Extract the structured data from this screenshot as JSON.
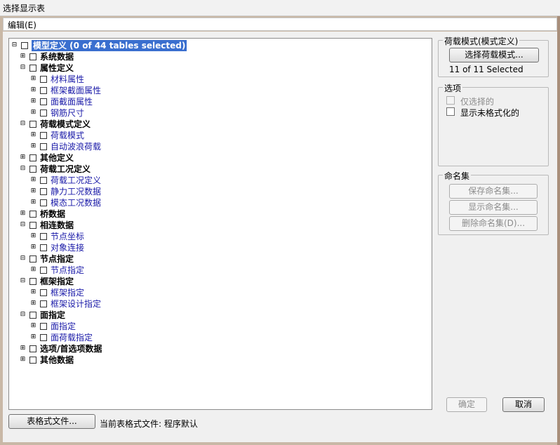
{
  "window": {
    "title": "选择显示表"
  },
  "menu": {
    "edit_label": "编辑(E)"
  },
  "tree": {
    "root_label": "模型定义  (0 of 44 tables selected)",
    "nodes": [
      {
        "label": "系统数据",
        "level": 1,
        "bold": true
      },
      {
        "label": "属性定义",
        "level": 1,
        "bold": true,
        "expanded": true
      },
      {
        "label": "材料属性",
        "level": 2
      },
      {
        "label": "框架截面属性",
        "level": 2
      },
      {
        "label": "面截面属性",
        "level": 2
      },
      {
        "label": "钢筋尺寸",
        "level": 2
      },
      {
        "label": "荷载模式定义",
        "level": 1,
        "bold": true,
        "expanded": true
      },
      {
        "label": "荷载模式",
        "level": 2
      },
      {
        "label": "自动波浪荷载",
        "level": 2
      },
      {
        "label": "其他定义",
        "level": 1,
        "bold": true
      },
      {
        "label": "荷载工况定义",
        "level": 1,
        "bold": true,
        "expanded": true
      },
      {
        "label": "荷载工况定义",
        "level": 2
      },
      {
        "label": "静力工况数据",
        "level": 2
      },
      {
        "label": "模态工况数据",
        "level": 2
      },
      {
        "label": "桥数据",
        "level": 1,
        "bold": true
      },
      {
        "label": "相连数据",
        "level": 1,
        "bold": true,
        "expanded": true
      },
      {
        "label": "节点坐标",
        "level": 2
      },
      {
        "label": "对象连接",
        "level": 2
      },
      {
        "label": "节点指定",
        "level": 1,
        "bold": true,
        "expanded": true
      },
      {
        "label": "节点指定",
        "level": 2
      },
      {
        "label": "框架指定",
        "level": 1,
        "bold": true,
        "expanded": true
      },
      {
        "label": "框架指定",
        "level": 2
      },
      {
        "label": "框架设计指定",
        "level": 2
      },
      {
        "label": "面指定",
        "level": 1,
        "bold": true,
        "expanded": true
      },
      {
        "label": "面指定",
        "level": 2
      },
      {
        "label": "面荷载指定",
        "level": 2
      },
      {
        "label": "选项/首选项数据",
        "level": 1,
        "bold": true
      },
      {
        "label": "其他数据",
        "level": 1,
        "bold": true
      }
    ]
  },
  "load_patterns": {
    "group_title": "荷载模式(模式定义)",
    "select_button": "选择荷载模式...",
    "status": "11 of 11 Selected"
  },
  "options": {
    "group_title": "选项",
    "only_selected": "仅选择的",
    "show_unformatted": "显示未格式化的"
  },
  "named_sets": {
    "group_title": "命名集",
    "save_button": "保存命名集...",
    "show_button": "显示命名集...",
    "delete_button": "删除命名集(D)..."
  },
  "footer": {
    "format_file_button": "表格式文件...",
    "current_format_label": "当前表格式文件: 程序默认",
    "ok_button": "确定",
    "cancel_button": "取消"
  },
  "colors": {
    "leaf_text": "#1a1aa8",
    "selection": "#3a6fcf"
  }
}
